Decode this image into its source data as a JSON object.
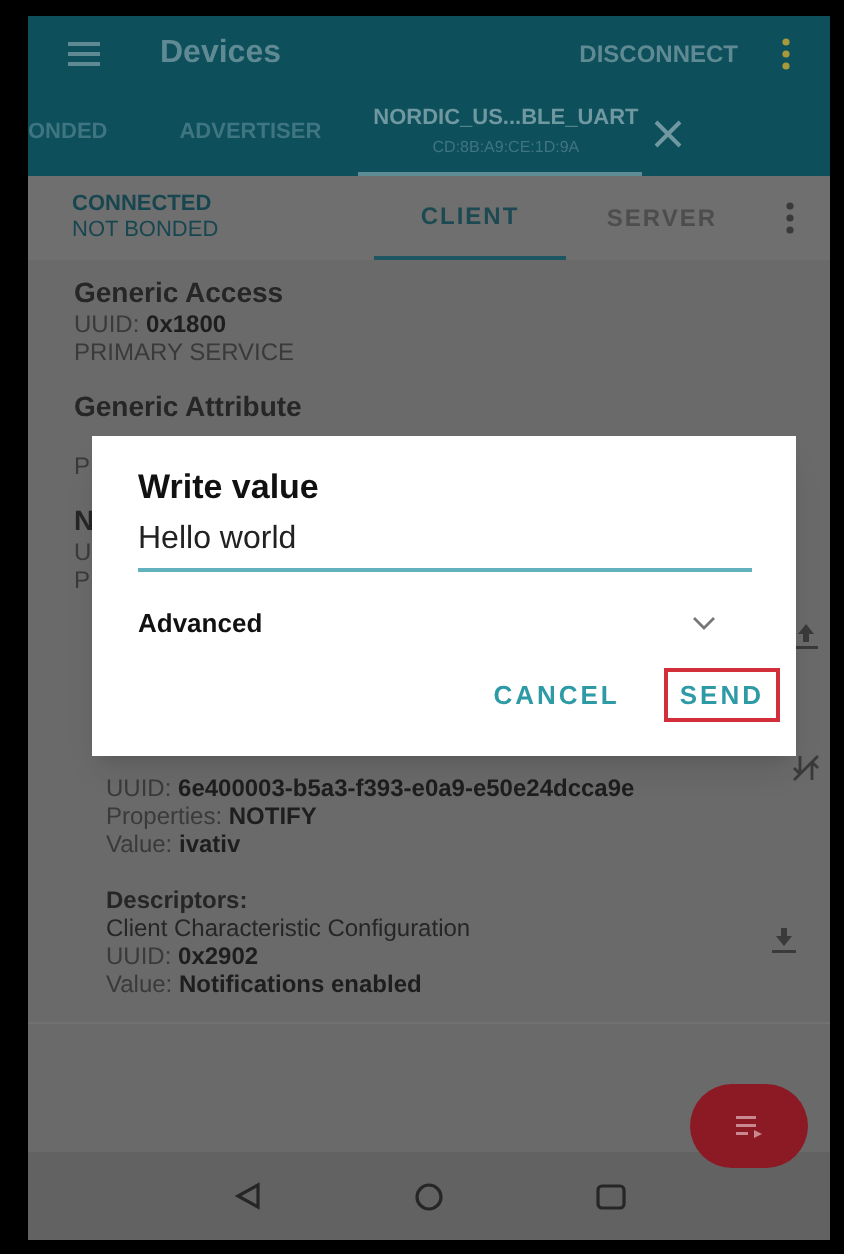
{
  "app_bar": {
    "title": "Devices",
    "action": "DISCONNECT"
  },
  "device_tabs": [
    {
      "label": "ONDED",
      "selected": false
    },
    {
      "label": "ADVERTISER",
      "selected": false
    },
    {
      "label": "NORDIC_US...BLE_UART",
      "subtitle": "CD:8B:A9:CE:1D:9A",
      "selected": true
    }
  ],
  "connection": {
    "state": "CONNECTED",
    "bond": "NOT BONDED"
  },
  "mode_tabs": [
    {
      "label": "CLIENT",
      "selected": true
    },
    {
      "label": "SERVER",
      "selected": false
    }
  ],
  "services": [
    {
      "name": "Generic Access",
      "uuid_label": "UUID:",
      "uuid": "0x1800",
      "type": "PRIMARY SERVICE"
    },
    {
      "name": "Generic Attribute",
      "type": "P"
    },
    {
      "name": "N",
      "uuid_label": "U",
      "type": "P"
    }
  ],
  "characteristic": {
    "uuid_label": "UUID:",
    "uuid": "6e400003-b5a3-f393-e0a9-e50e24dcca9e",
    "properties_label": "Properties:",
    "properties": "NOTIFY",
    "value_label": "Value:",
    "value": "ivativ"
  },
  "descriptors": {
    "heading": "Descriptors:",
    "name": "Client Characteristic Configuration",
    "uuid_label": "UUID:",
    "uuid": "0x2902",
    "value_label": "Value:",
    "value": "Notifications enabled"
  },
  "dialog": {
    "title": "Write value",
    "value": "Hello world",
    "advanced": "Advanced",
    "expanded": false,
    "buttons": [
      {
        "label": "CANCEL",
        "highlighted": false
      },
      {
        "label": "SEND",
        "highlighted": true
      }
    ]
  }
}
